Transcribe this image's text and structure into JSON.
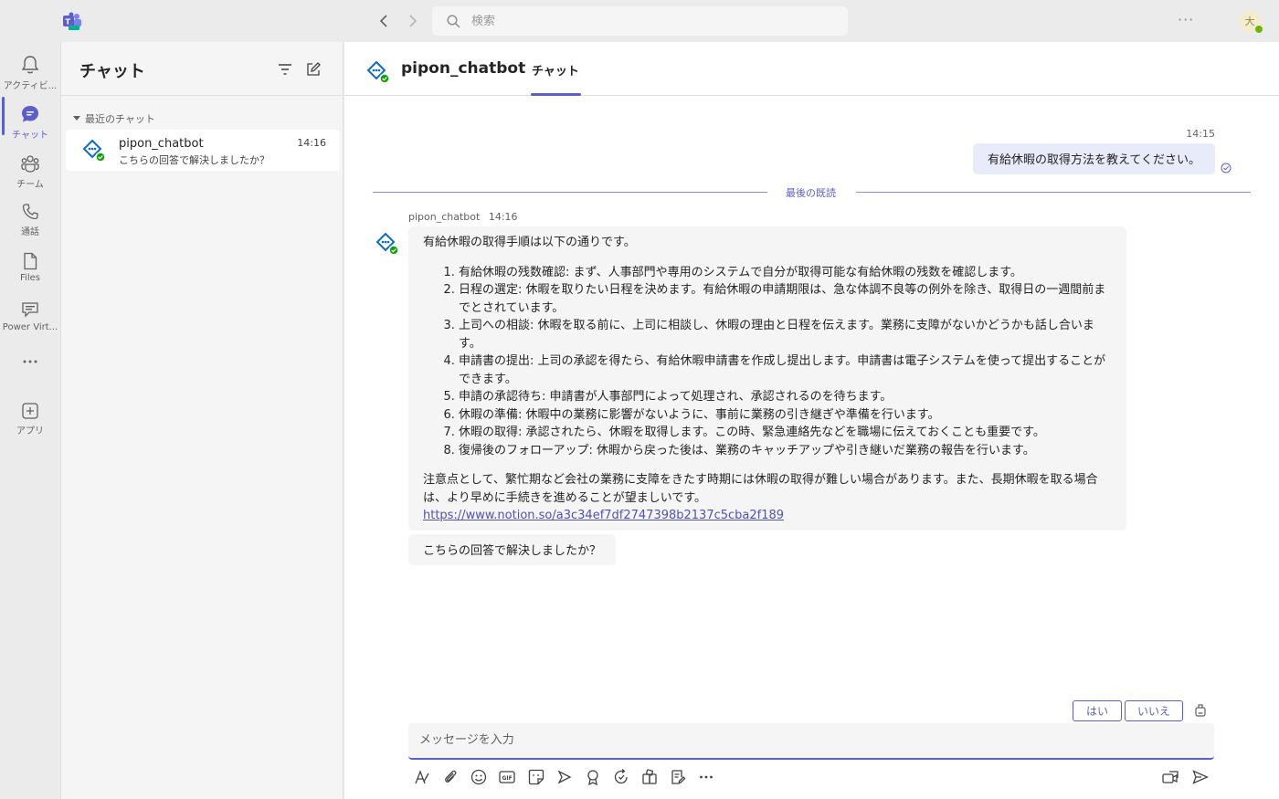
{
  "titlebar": {
    "search_placeholder": "検索",
    "more": "···",
    "avatar_initial": "大"
  },
  "rail": {
    "items": [
      {
        "label": "アクティビ...",
        "icon": "bell-icon"
      },
      {
        "label": "チャット",
        "icon": "chat-icon",
        "active": true
      },
      {
        "label": "チーム",
        "icon": "teams-icon"
      },
      {
        "label": "通話",
        "icon": "phone-icon"
      },
      {
        "label": "Files",
        "icon": "file-icon"
      },
      {
        "label": "Power Virt...",
        "icon": "power-virtual-agents-icon"
      },
      {
        "label": "",
        "icon": "more-icon"
      },
      {
        "label": "アプリ",
        "icon": "add-apps-icon"
      }
    ]
  },
  "chatlist": {
    "title": "チャット",
    "section_label": "最近のチャット",
    "entries": [
      {
        "name": "pipon_chatbot",
        "time": "14:16",
        "preview": "こちらの回答で解決しましたか？"
      }
    ]
  },
  "header": {
    "bot_name": "pipon_chatbot",
    "tab_label": "チャット"
  },
  "messages": {
    "sent": {
      "time": "14:15",
      "text": "有給休暇の取得方法を教えてください。"
    },
    "divider_label": "最後の既読",
    "bot": {
      "sender": "pipon_chatbot",
      "time": "14:16",
      "intro": "有給休暇の取得手順は以下の通りです。",
      "steps": [
        "有給休暇の残数確認: まず、人事部門や専用のシステムで自分が取得可能な有給休暇の残数を確認します。",
        "日程の選定: 休暇を取りたい日程を決めます。有給休暇の申請期限は、急な体調不良等の例外を除き、取得日の一週間前までとされています。",
        "上司への相談: 休暇を取る前に、上司に相談し、休暇の理由と日程を伝えます。業務に支障がないかどうかも話し合います。",
        "申請書の提出: 上司の承認を得たら、有給休暇申請書を作成し提出します。申請書は電子システムを使って提出することができます。",
        "申請の承認待ち: 申請書が人事部門によって処理され、承認されるのを待ちます。",
        "休暇の準備: 休暇中の業務に影響がないように、事前に業務の引き継ぎや準備を行います。",
        "休暇の取得: 承認されたら、休暇を取得します。この時、緊急連絡先などを職場に伝えておくことも重要です。",
        "復帰後のフォローアップ: 休暇から戻った後は、業務のキャッチアップや引き継いだ業務の報告を行います。"
      ],
      "note": "注意点として、繁忙期など会社の業務に支障をきたす時期には休暇の取得が難しい場合があります。また、長期休暇を取る場合は、より早めに手続きを進めることが望ましいです。",
      "link": "https://www.notion.so/a3c34ef7df2747398b2137c5cba2f189",
      "followup": "こちらの回答で解決しましたか？"
    }
  },
  "suggestions": {
    "yes": "はい",
    "no": "いいえ"
  },
  "compose": {
    "placeholder": "メッセージを入力"
  },
  "colors": {
    "accent": "#5b5fc7",
    "presence": "#6bb700",
    "bot_blue": "#0f6cbd"
  }
}
